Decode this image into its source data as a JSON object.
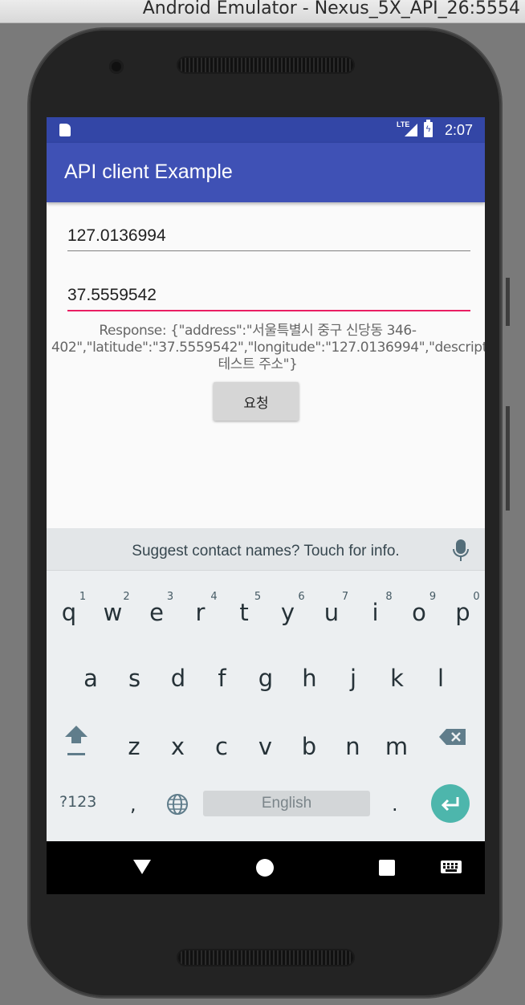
{
  "window": {
    "title": "Android Emulator - Nexus_5X_API_26:5554"
  },
  "status_bar": {
    "network": "LTE",
    "time": "2:07"
  },
  "app_bar": {
    "title": "API client Example"
  },
  "form": {
    "longitude_value": "127.0136994",
    "latitude_value": "37.5559542",
    "response_text": "Response: {\"address\":\"서울특별시 중구 신당동 346-402\",\"latitude\":\"37.5559542\",\"longitude\":\"127.0136994\",\"description\":\"API 테스트 주소\"}",
    "request_button_label": "요청"
  },
  "keyboard": {
    "suggestion": "Suggest contact names? Touch for info.",
    "row1": [
      "q",
      "w",
      "e",
      "r",
      "t",
      "y",
      "u",
      "i",
      "o",
      "p"
    ],
    "row1_hints": [
      "1",
      "2",
      "3",
      "4",
      "5",
      "6",
      "7",
      "8",
      "9",
      "0"
    ],
    "row2": [
      "a",
      "s",
      "d",
      "f",
      "g",
      "h",
      "j",
      "k",
      "l"
    ],
    "row3": [
      "z",
      "x",
      "c",
      "v",
      "b",
      "n",
      "m"
    ],
    "symbols_label": "?123",
    "comma_label": ",",
    "space_label": "English",
    "period_label": ".",
    "accent_color": "#4db6ac"
  },
  "colors": {
    "primary": "#3f51b5",
    "primary_dark": "#3346a6",
    "focus_underline": "#e91e63"
  }
}
